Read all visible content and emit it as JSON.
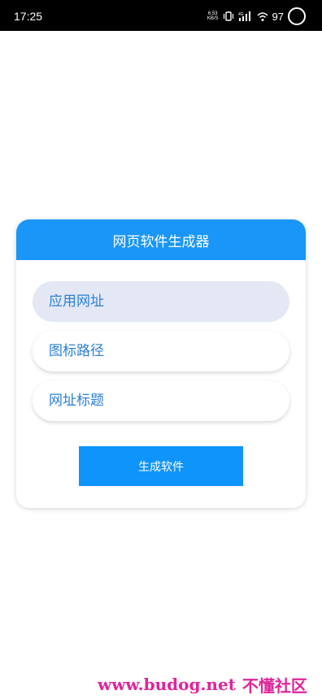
{
  "status_bar": {
    "time": "17:25",
    "net_speed_value": "6.53",
    "net_speed_unit": "KB/S",
    "battery": "97"
  },
  "card": {
    "title": "网页软件生成器",
    "fields": [
      {
        "placeholder": "应用网址"
      },
      {
        "placeholder": "图标路径"
      },
      {
        "placeholder": "网址标题"
      }
    ],
    "generate_button": "生成软件"
  },
  "watermark": {
    "url": "www.budog.net",
    "cn": "不懂社区"
  },
  "colors": {
    "header_blue": "#1a96f8",
    "button_blue": "#0f94fb",
    "field_text": "#2b7fd6",
    "active_field_bg": "#e4e8f5",
    "watermark": "#e0249b"
  },
  "icons": [
    "vibrate-icon",
    "signal-4g-icon",
    "wifi-icon",
    "battery-ring-icon"
  ]
}
